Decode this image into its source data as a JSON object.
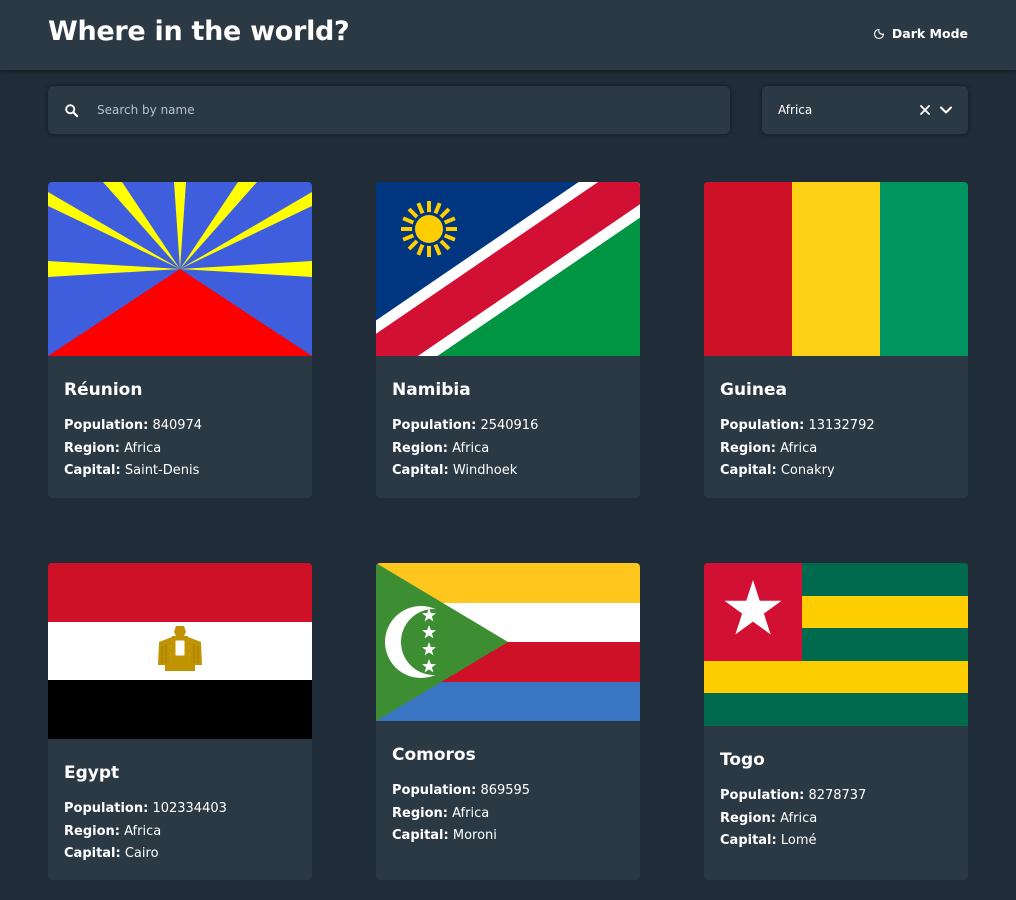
{
  "header": {
    "title": "Where in the world?",
    "theme_toggle_label": "Dark Mode"
  },
  "search": {
    "placeholder": "Search by name",
    "value": ""
  },
  "filter": {
    "selected": "Africa"
  },
  "labels": {
    "population": "Population:",
    "region": "Region:",
    "capital": "Capital:"
  },
  "countries": [
    {
      "name": "Réunion",
      "population": "840974",
      "region": "Africa",
      "capital": "Saint-Denis"
    },
    {
      "name": "Namibia",
      "population": "2540916",
      "region": "Africa",
      "capital": "Windhoek"
    },
    {
      "name": "Guinea",
      "population": "13132792",
      "region": "Africa",
      "capital": "Conakry"
    },
    {
      "name": "Egypt",
      "population": "102334403",
      "region": "Africa",
      "capital": "Cairo"
    },
    {
      "name": "Comoros",
      "population": "869595",
      "region": "Africa",
      "capital": "Moroni"
    },
    {
      "name": "Togo",
      "population": "8278737",
      "region": "Africa",
      "capital": "Lomé"
    }
  ],
  "colors": {
    "background": "#202c37",
    "elements": "#2b3945",
    "text": "#ffffff"
  }
}
